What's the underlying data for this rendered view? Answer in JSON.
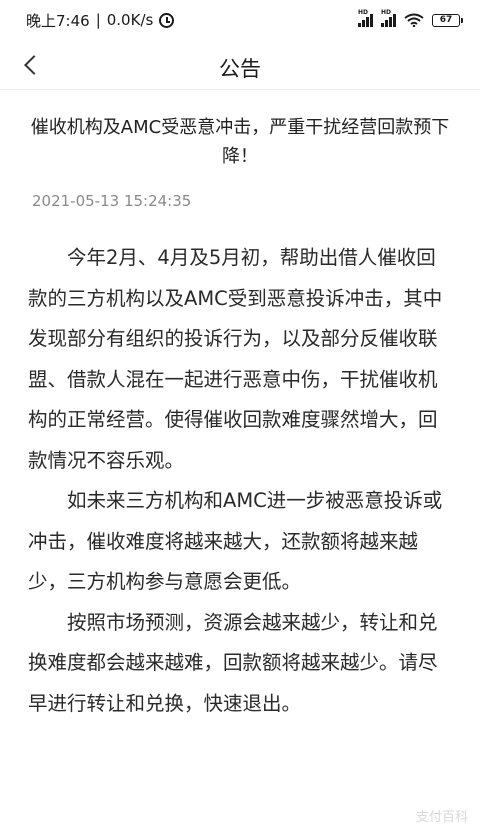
{
  "status_bar": {
    "time": "晚上7:46",
    "separator": "|",
    "net_speed": "0.0K/s",
    "signal_1_label": "HD",
    "signal_2_label": "HD",
    "battery": "67"
  },
  "nav": {
    "title": "公告"
  },
  "article": {
    "title": "催收机构及AMC受恶意冲击，严重干扰经营回款预下降！",
    "date": "2021-05-13 15:24:35",
    "paragraphs": [
      "今年2月、4月及5月初，帮助出借人催收回款的三方机构以及AMC受到恶意投诉冲击，其中发现部分有组织的投诉行为，以及部分反催收联盟、借款人混在一起进行恶意中伤，干扰催收机构的正常经营。使得催收回款难度骤然增大，回款情况不容乐观。",
      "如未来三方机构和AMC进一步被恶意投诉或冲击，催收难度将越来越大，还款额将越来越少，三方机构参与意愿会更低。",
      "按照市场预测，资源会越来越少，转让和兑换难度都会越来越难，回款额将越来越少。请尽早进行转让和兑换，快速退出。"
    ]
  },
  "watermark": "支付百科"
}
